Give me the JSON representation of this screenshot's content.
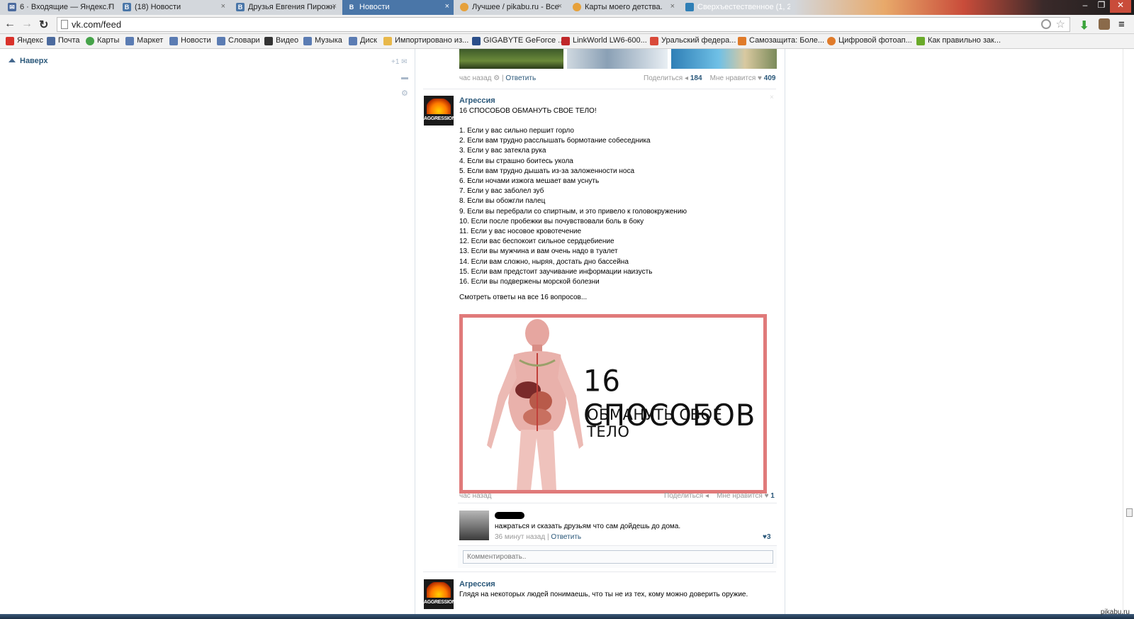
{
  "browser": {
    "tabs": [
      {
        "label": "6 · Входящие — Яндекс.П",
        "icon": "mail-icon"
      },
      {
        "label": "(18) Новости",
        "icon": "vk-icon"
      },
      {
        "label": "Друзья Евгения Пирожн",
        "icon": "vk-icon"
      },
      {
        "label": "Новости",
        "icon": "vk-icon",
        "active": true
      },
      {
        "label": "Лучшее / pikabu.ru - Все",
        "icon": "pikabu-icon"
      },
      {
        "label": "Карты моего детства.",
        "icon": "pikabu-icon"
      },
      {
        "label": "Сверхъестественное (1, 2",
        "icon": "tv-icon"
      }
    ],
    "url": "vk.com/feed",
    "bookmarks": [
      {
        "label": "Яндекс",
        "color": "#d9322b"
      },
      {
        "label": "Почта",
        "color": "#4b6a9e"
      },
      {
        "label": "Карты",
        "color": "#46a34a"
      },
      {
        "label": "Маркет",
        "color": "#5b7cb3"
      },
      {
        "label": "Новости",
        "color": "#5b7cb3"
      },
      {
        "label": "Словари",
        "color": "#5b7cb3"
      },
      {
        "label": "Видео",
        "color": "#333333"
      },
      {
        "label": "Музыка",
        "color": "#5b7cb3"
      },
      {
        "label": "Диск",
        "color": "#5b7cb3"
      },
      {
        "label": "Импортировано из...",
        "color": "#e8b84a"
      },
      {
        "label": "GIGABYTE GeForce ...",
        "color": "#2b4f8a"
      },
      {
        "label": "LinkWorld LW6-600...",
        "color": "#c0282a"
      },
      {
        "label": "Уральский федера...",
        "color": "#d94a3a"
      },
      {
        "label": "Самозащита: Боле...",
        "color": "#e07b2a"
      },
      {
        "label": "Цифровой фотоап...",
        "color": "#e07b2a"
      },
      {
        "label": "Как правильно зак...",
        "color": "#6aaa2a"
      }
    ]
  },
  "left": {
    "up_label": "Наверх",
    "counter": "+1"
  },
  "prev_post": {
    "time": "час назад",
    "reply": "Ответить",
    "share_label": "Поделиться",
    "share_count": "184",
    "like_label": "Мне нравится",
    "like_count": "409"
  },
  "post": {
    "author": "Агрессия",
    "avatar_text": "AGGRESSION",
    "title": "16 СПОСОБОВ ОБМАНУТЬ СВОЕ ТЕЛО!",
    "items": [
      "1. Если у вас сильно першит горло",
      "2. Если вам трудно расслышать бормотание собеседника",
      "3. Если у вас затекла рука",
      "4. Если вы страшно боитесь укола",
      "5. Если вам трудно дышать из-за заложенности носа",
      "6. Если ночами изжога мешает вам уснуть",
      "7. Если у вас заболел зуб",
      "8. Если вы обожгли палец",
      "9. Если вы перебрали со спиртным, и это привело к головокружению",
      "10. Если после пробежки вы почувствовали боль в боку",
      "11. Если у вас носовое кровотечение",
      "12. Если вас беспокоит сильное сердцебиение",
      "13. Если вы мужчина и вам очень надо в туалет",
      "14. Если вам сложно, ныряя, достать дно бассейна",
      "15. Если вам предстоит заучивание информации наизусть",
      "16. Если вы подвержены морской болезни"
    ],
    "more_link": "Смотреть ответы на все 16 вопросов...",
    "image_title": "16 СПОСОБОВ",
    "image_subtitle": "ОБМАНУТЬ СВОЕ ТЕЛО",
    "time": "час назад",
    "share_label": "Поделиться",
    "like_label": "Мне нравится",
    "like_count": "1",
    "comment": {
      "text": "нажраться и сказать друзьям что сам дойдешь до дома.",
      "time": "36 минут назад",
      "reply": "Ответить",
      "likes": "3"
    },
    "comment_placeholder": "Комментировать.."
  },
  "next_post": {
    "author": "Агрессия",
    "text": "Глядя на некоторых людей понимаешь, что ты не из тех, кому можно доверить оружие."
  },
  "watermark": "pikabu.ru"
}
